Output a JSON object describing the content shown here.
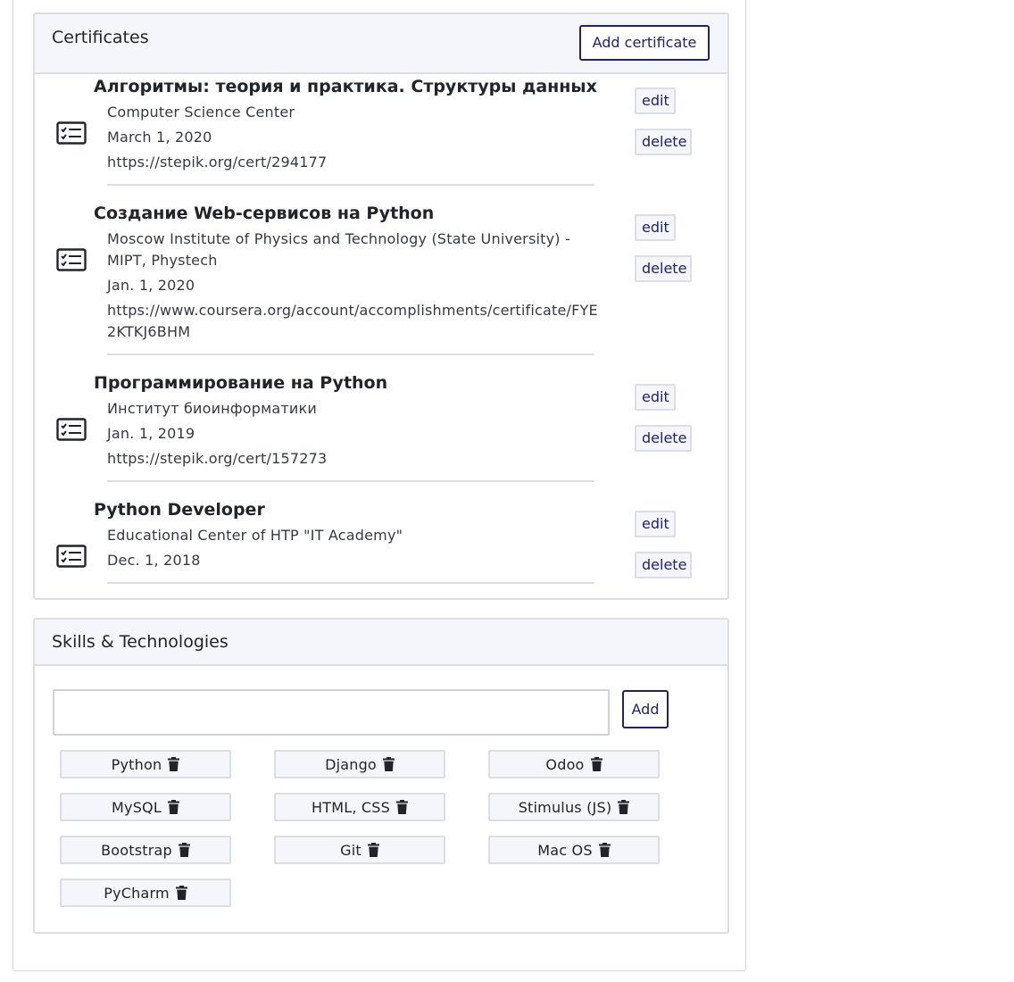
{
  "certificates": {
    "title": "Certificates",
    "add_label": "Add certificate",
    "edit_label": "edit",
    "delete_label": "delete",
    "items": [
      {
        "title": "Алгоритмы: теория и практика. Структуры данных",
        "issuer": "Computer Science Center",
        "date": "March 1, 2020",
        "url": "https://stepik.org/cert/294177"
      },
      {
        "title": "Создание Web-сервисов на Python",
        "issuer_line1": "Moscow Institute of Physics and Technology (State University) -",
        "issuer_line2": "MIPT, Phystech",
        "date": "Jan. 1, 2020",
        "url_line1": "https://www.coursera.org/account/accomplishments/certificate/FYE",
        "url_line2": "2KTKJ6BHM"
      },
      {
        "title": "Программирование на Python",
        "issuer": "Институт биоинформатики",
        "date": "Jan. 1, 2019",
        "url": "https://stepik.org/cert/157273"
      },
      {
        "title": "Python Developer",
        "issuer": "Educational Center of HTP \"IT Academy\"",
        "date": "Dec. 1, 2018"
      }
    ]
  },
  "skills": {
    "title": "Skills & Technologies",
    "input_value": "",
    "add_label": "Add",
    "tags": [
      "Python",
      "Django",
      "Odoo",
      "MySQL",
      "HTML, CSS",
      "Stimulus (JS)",
      "Bootstrap",
      "Git",
      "Mac OS",
      "PyCharm"
    ]
  },
  "colors": {
    "accent": "#1f236e",
    "header_bg": "#f4f6fb",
    "border": "#dcdee2"
  }
}
